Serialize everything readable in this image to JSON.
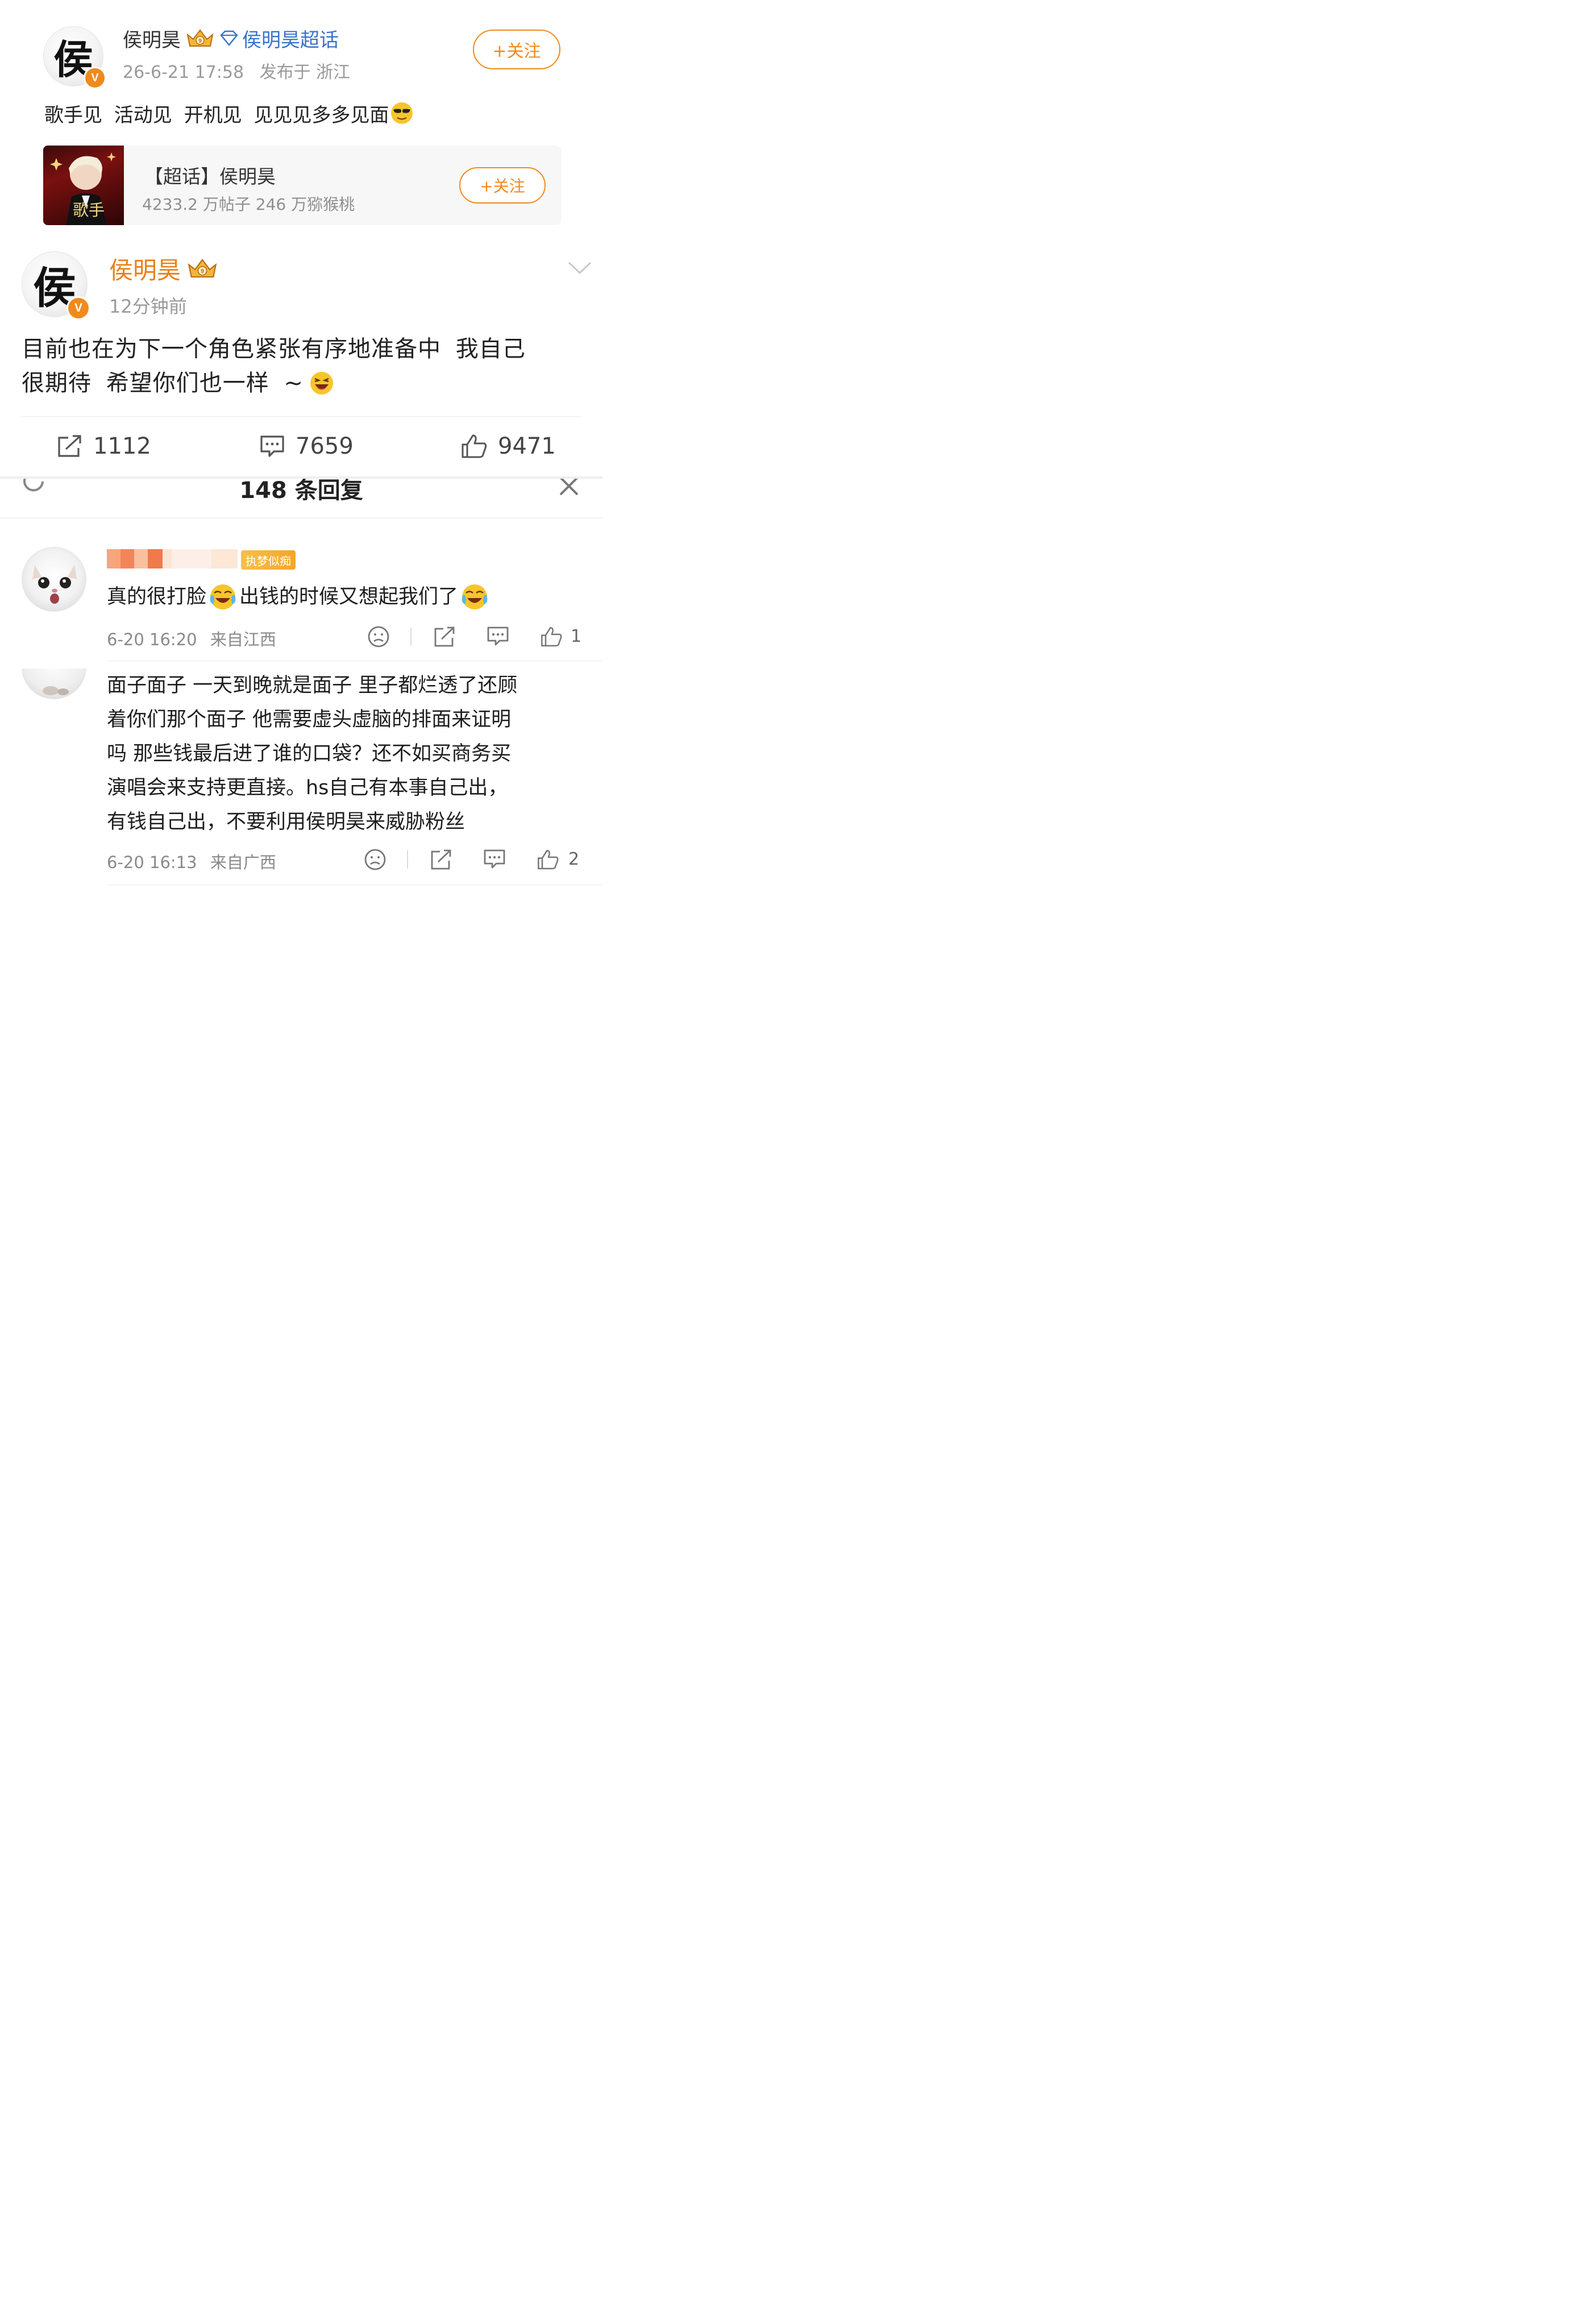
{
  "post1": {
    "author": "侯明昊",
    "avatar_char": "侯",
    "badge": "V",
    "topic_link": "侯明昊超话",
    "time": "26-6-21 17:58",
    "location": "发布于 浙江",
    "follow_label": "+关注",
    "text": "歌手见 活动见 开机见 见见见多多见面",
    "card": {
      "title": "【超话】侯明昊",
      "stats": "4233.2 万帖子 246 万猕猴桃",
      "follow_label": "+关注",
      "image_text": "歌手"
    }
  },
  "post2": {
    "author": "侯明昊",
    "avatar_char": "侯",
    "badge": "V",
    "time": "12分钟前",
    "text_line1": "目前也在为下一个角色紧张有序地准备中 我自己",
    "text_line2": "很期待 希望你们也一样 ~",
    "stats": {
      "repost": "1112",
      "comment": "7659",
      "like": "9471"
    }
  },
  "replies_header": {
    "title": "148 条回复"
  },
  "comments": [
    {
      "tag": "执梦似痴",
      "text_part1": "真的很打脸",
      "text_part2": "出钱的时候又想起我们了",
      "time": "6-20 16:20",
      "location": "来自江西",
      "likes": "1"
    },
    {
      "line1": "面子面子 一天到晚就是面子 里子都烂透了还顾",
      "line2": "着你们那个面子 他需要虚头虚脑的排面来证明",
      "line3": "吗 那些钱最后进了谁的口袋？还不如买商务买",
      "line4": "演唱会来支持更直接。hs自己有本事自己出，",
      "line5": "有钱自己出，不要利用侯明昊来威胁粉丝",
      "time": "6-20 16:13",
      "location": "来自广西",
      "likes": "2"
    }
  ],
  "colors": {
    "accent": "#f08a1c",
    "link": "#3a73c9",
    "name_orange": "#e8811a"
  }
}
